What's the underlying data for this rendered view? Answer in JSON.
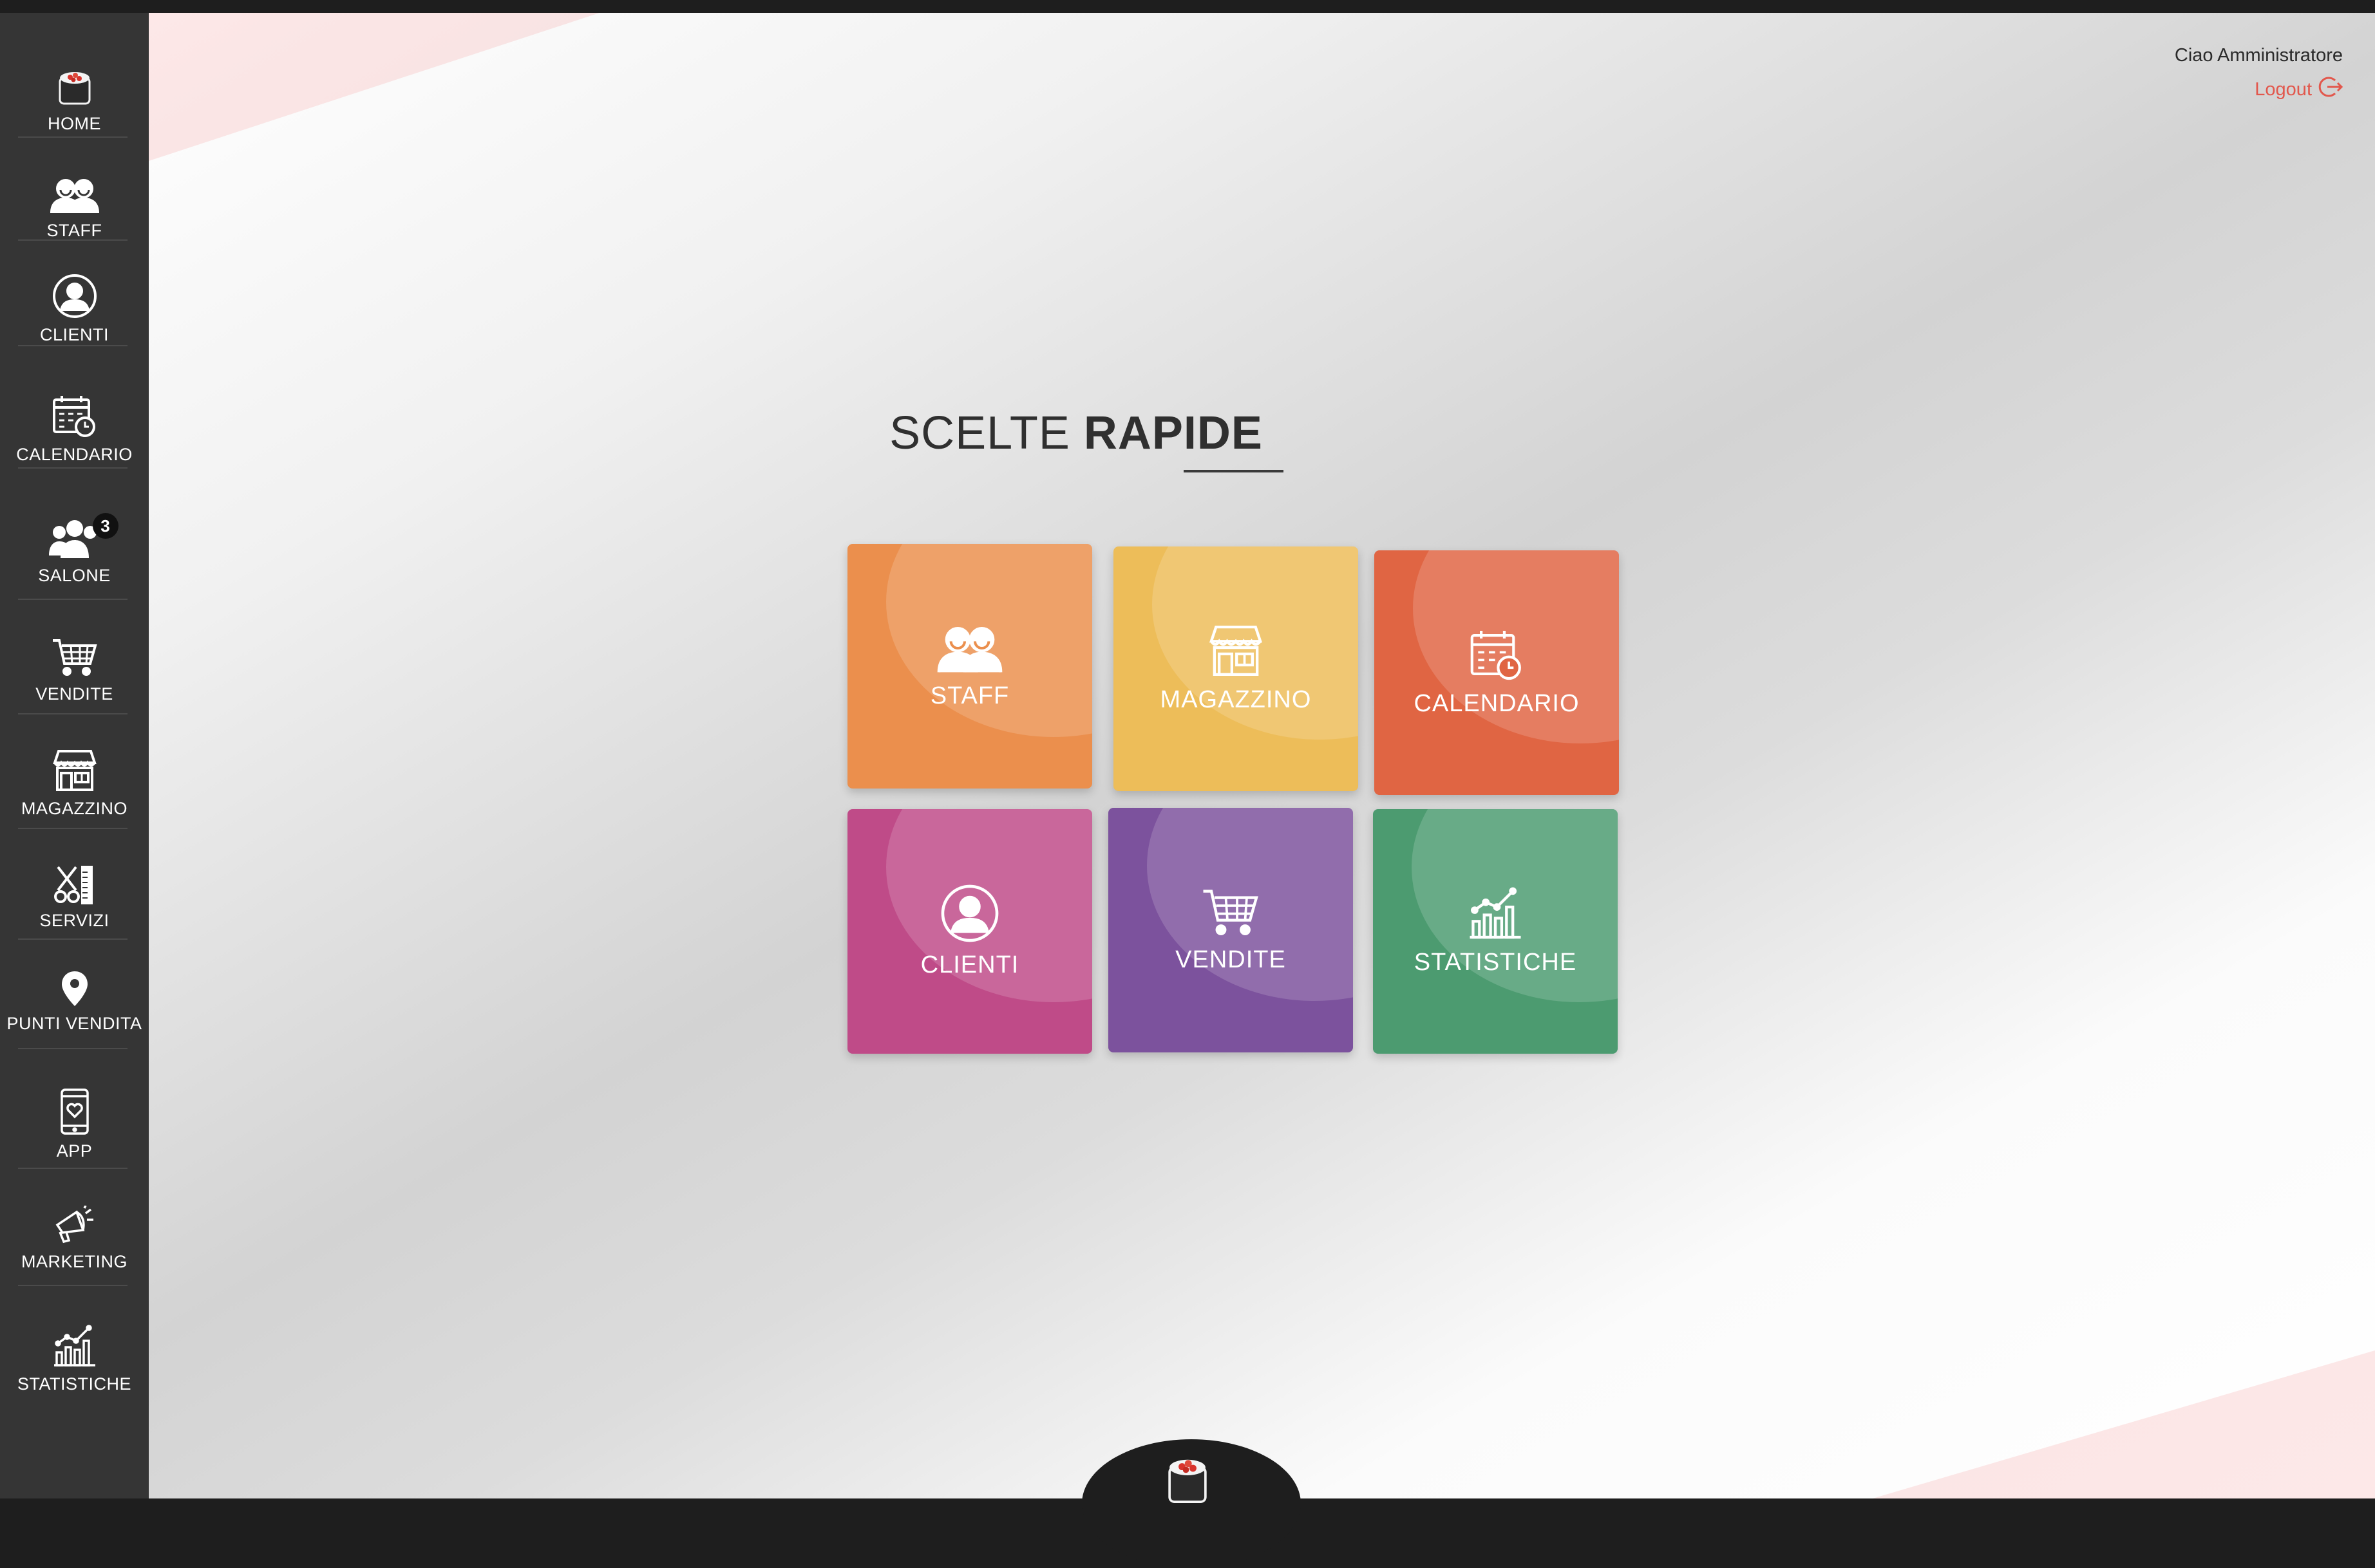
{
  "sidebar": {
    "items": [
      {
        "label": "HOME",
        "icon": "sushi-logo-icon"
      },
      {
        "label": "STAFF",
        "icon": "staff-icon"
      },
      {
        "label": "CLIENTI",
        "icon": "user-circle-icon"
      },
      {
        "label": "CALENDARIO",
        "icon": "calendar-clock-icon"
      },
      {
        "label": "SALONE",
        "icon": "group-icon",
        "badge": "3"
      },
      {
        "label": "VENDITE",
        "icon": "cart-icon"
      },
      {
        "label": "MAGAZZINO",
        "icon": "store-icon"
      },
      {
        "label": "SERVIZI",
        "icon": "scissors-comb-icon"
      },
      {
        "label": "PUNTI VENDITA",
        "icon": "map-pin-icon"
      },
      {
        "label": "APP",
        "icon": "smartphone-heart-icon"
      },
      {
        "label": "MARKETING",
        "icon": "megaphone-icon"
      },
      {
        "label": "STATISTICHE",
        "icon": "bar-chart-icon"
      }
    ]
  },
  "header": {
    "greeting": "Ciao Amministratore",
    "logout_label": "Logout"
  },
  "main": {
    "title_light": "SCELTE",
    "title_bold": "RAPIDE",
    "tiles": [
      {
        "label": "STAFF",
        "icon": "staff-icon",
        "color": "#eb8f4d"
      },
      {
        "label": "MAGAZZINO",
        "icon": "store-icon",
        "color": "#edbd59"
      },
      {
        "label": "CALENDARIO",
        "icon": "calendar-clock-icon",
        "color": "#e06543"
      },
      {
        "label": "CLIENTI",
        "icon": "user-circle-icon",
        "color": "#bf4b88"
      },
      {
        "label": "VENDITE",
        "icon": "cart-icon",
        "color": "#7c529d"
      },
      {
        "label": "STATISTICHE",
        "icon": "bar-chart-icon",
        "color": "#4c9b70"
      }
    ]
  },
  "colors": {
    "sidebar": "#353535",
    "frame": "#1e1e1e",
    "accent_logout": "#e2574c"
  }
}
